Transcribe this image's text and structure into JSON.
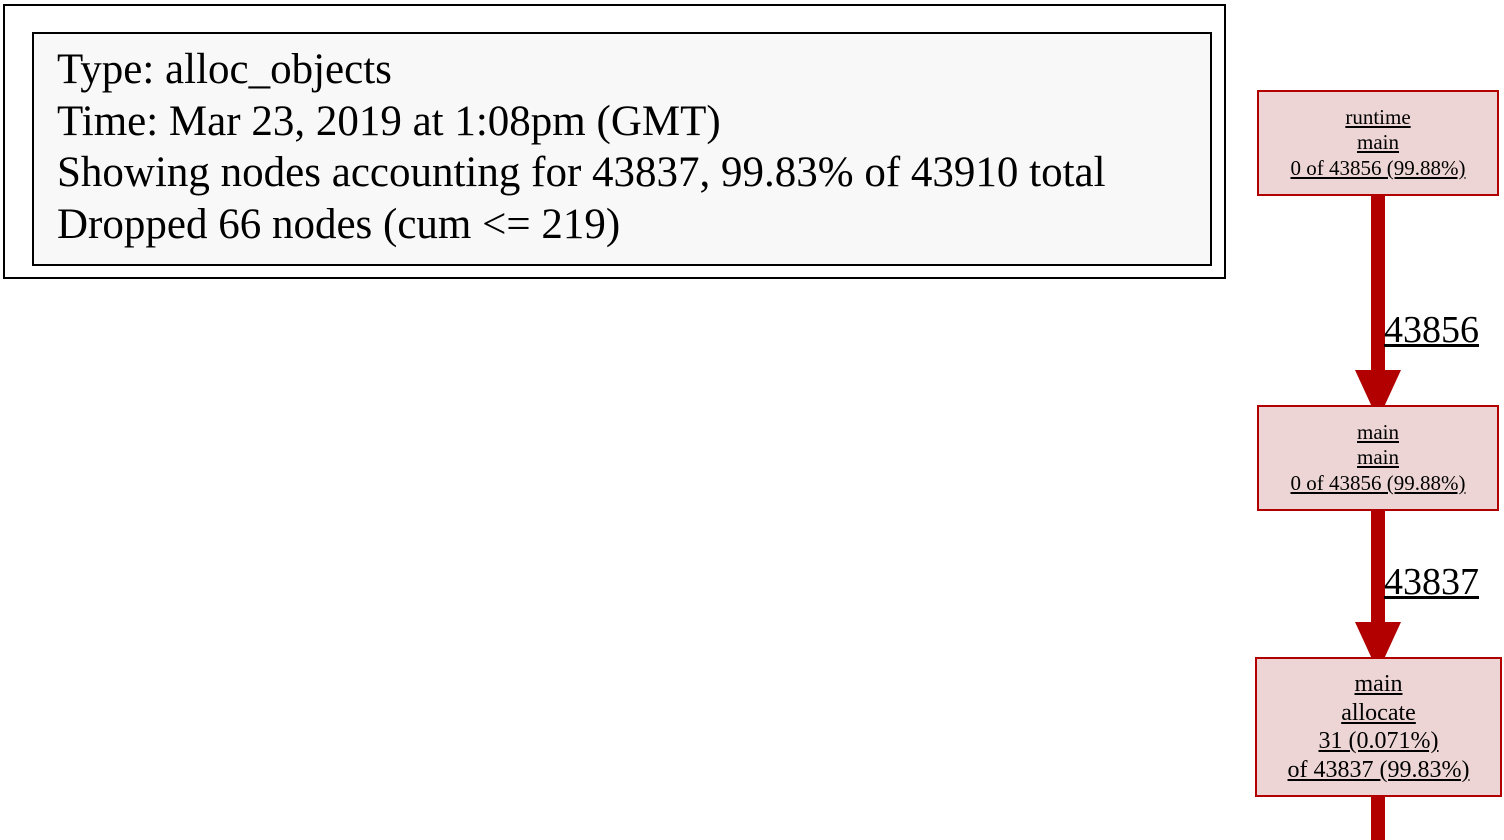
{
  "legend": {
    "type_line": "Type: alloc_objects",
    "time_line": "Time: Mar 23, 2019 at 1:08pm (GMT)",
    "showing_line": "Showing nodes accounting for 43837, 99.83% of 43910 total",
    "dropped_line": "Dropped 66 nodes (cum <= 219)"
  },
  "colors": {
    "node_border": "#b20000",
    "node_fill": "#edd5d5",
    "edge": "#b20000",
    "legend_fill": "#f8f8f8"
  },
  "nodes": [
    {
      "package": "runtime",
      "function": "main",
      "value_line": "0 of 43856 (99.88%)"
    },
    {
      "package": "main",
      "function": "main",
      "value_line": "0 of 43856 (99.88%)"
    },
    {
      "package": "main",
      "function": "allocate",
      "flat_line": "31 (0.071%)",
      "cum_line": "of 43837 (99.83%)"
    }
  ],
  "edges": [
    {
      "from": "runtime main",
      "to": "main main",
      "label": "43856"
    },
    {
      "from": "main main",
      "to": "main allocate",
      "label": "43837"
    }
  ]
}
